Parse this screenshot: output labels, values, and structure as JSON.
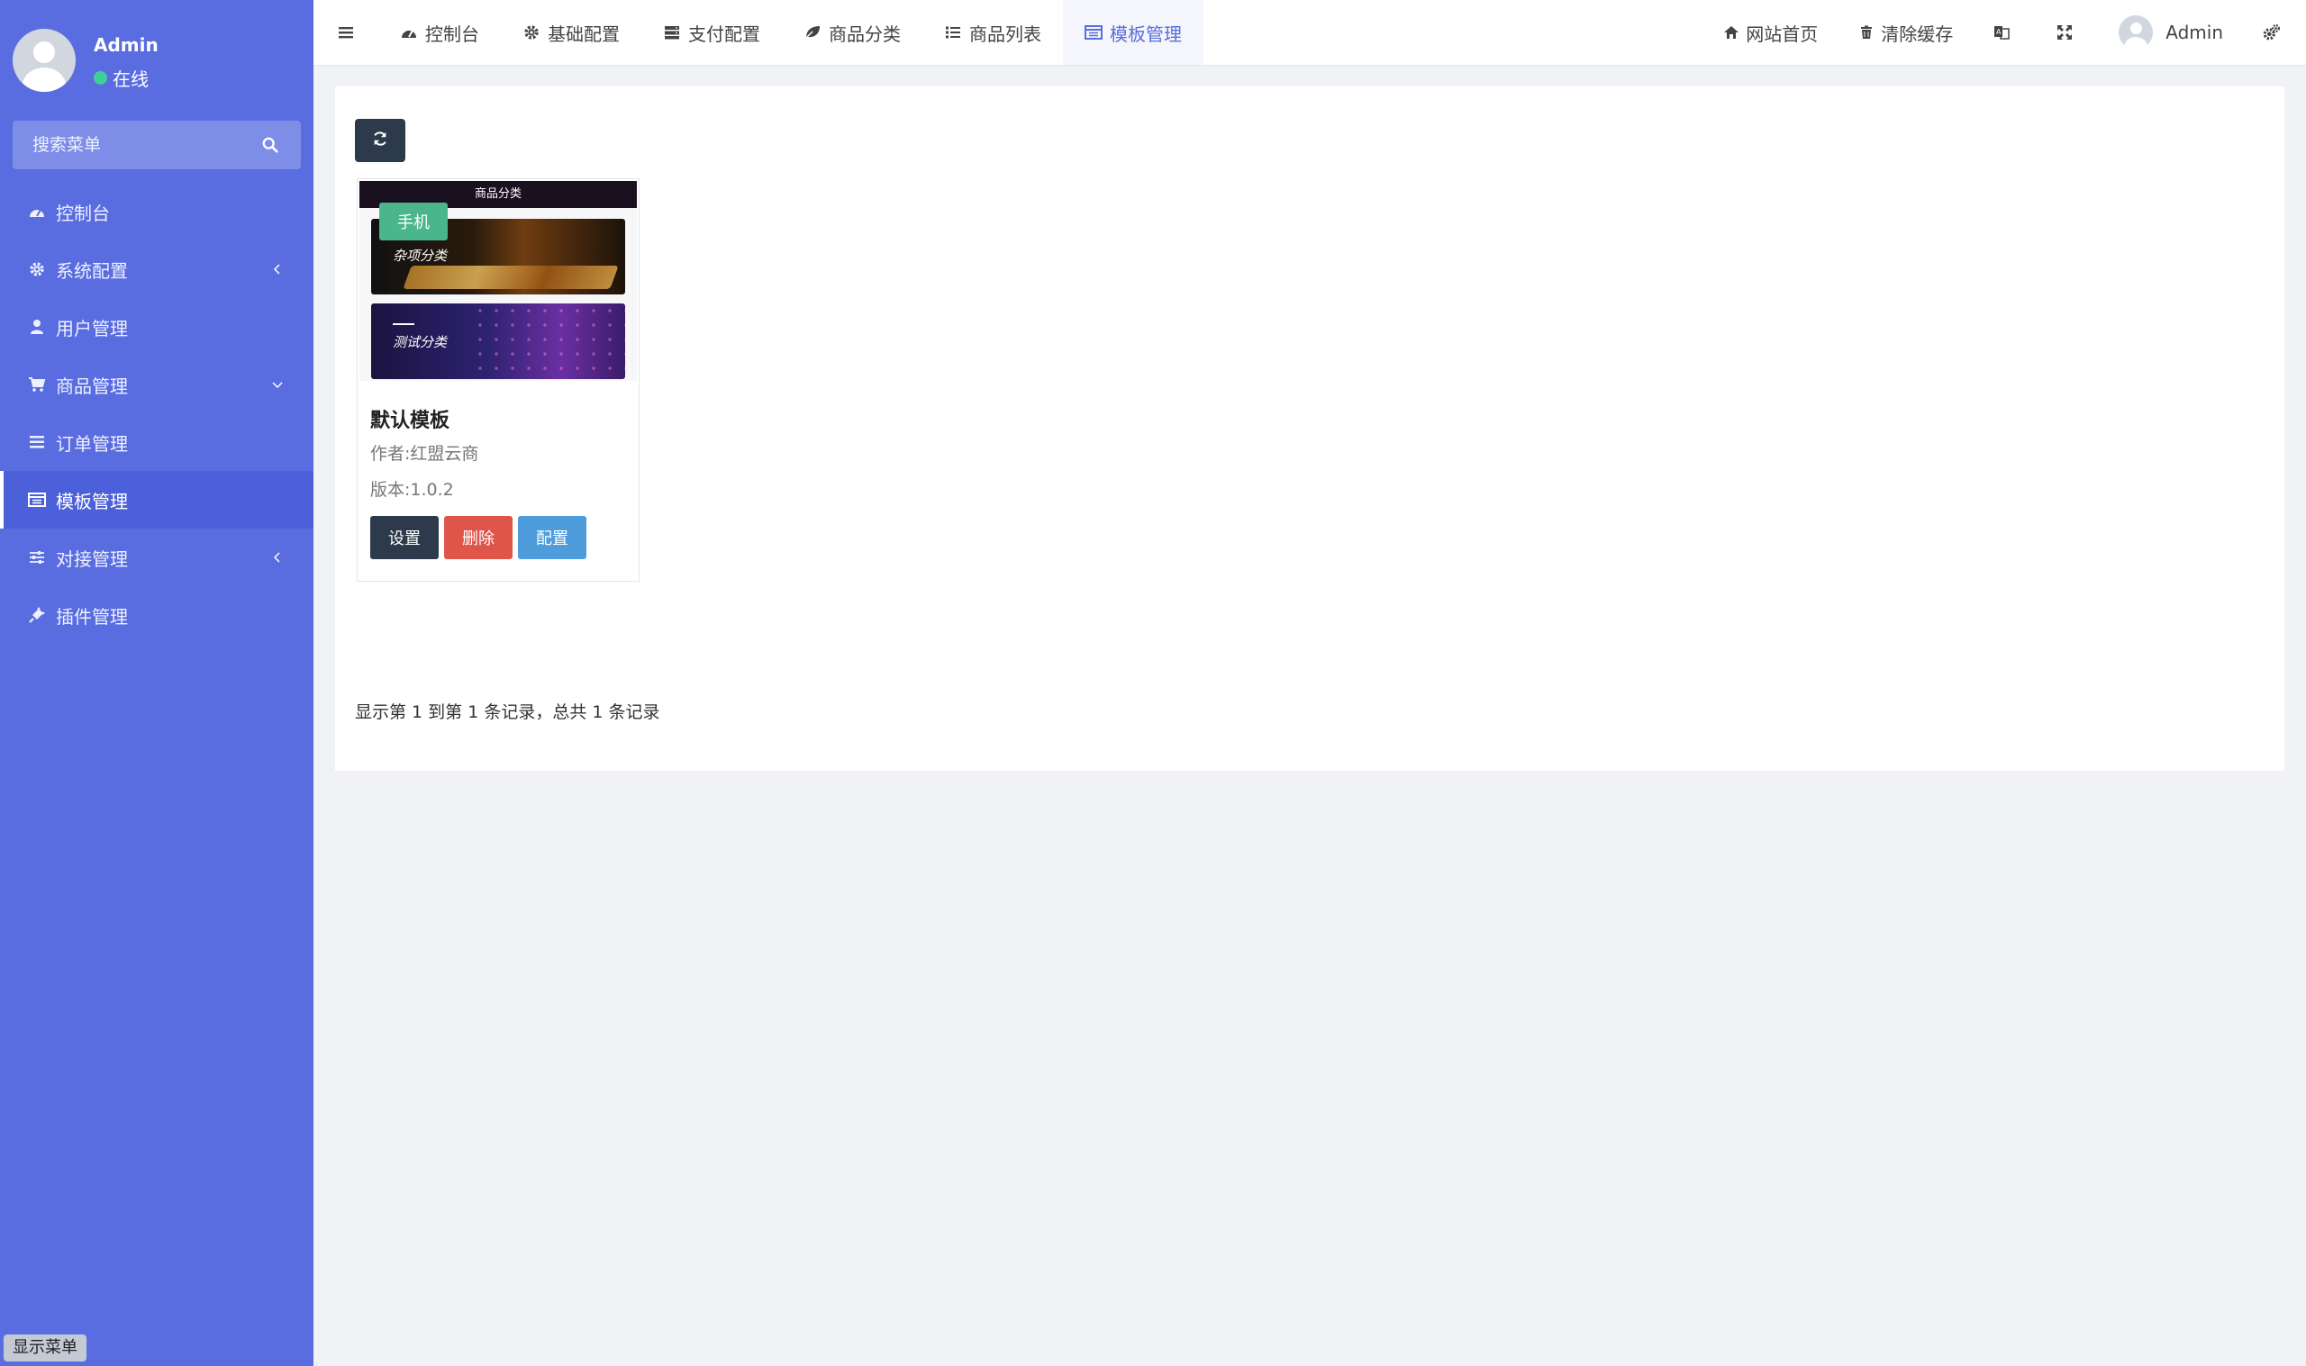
{
  "sidebar": {
    "user": {
      "name": "Admin",
      "status": "在线"
    },
    "search": {
      "placeholder": "搜索菜单"
    },
    "items": [
      {
        "label": "控制台"
      },
      {
        "label": "系统配置"
      },
      {
        "label": "用户管理"
      },
      {
        "label": "商品管理"
      },
      {
        "label": "订单管理"
      },
      {
        "label": "模板管理"
      },
      {
        "label": "对接管理"
      },
      {
        "label": "插件管理"
      }
    ],
    "show_menu_label": "显示菜单"
  },
  "topbar": {
    "tabs": [
      {
        "label": "控制台"
      },
      {
        "label": "基础配置"
      },
      {
        "label": "支付配置"
      },
      {
        "label": "商品分类"
      },
      {
        "label": "商品列表"
      },
      {
        "label": "模板管理"
      }
    ],
    "right": {
      "home_label": "网站首页",
      "clear_cache_label": "清除缓存",
      "user_label": "Admin"
    }
  },
  "templates": [
    {
      "preview_header": "商品分类",
      "preview_banner1": "杂项分类",
      "preview_banner2": "测试分类",
      "device_badge": "手机",
      "name": "默认模板",
      "author": "作者:红盟云商",
      "version": "版本:1.0.2",
      "actions": {
        "settings": "设置",
        "delete": "删除",
        "config": "配置"
      }
    }
  ],
  "pagination": {
    "info": "显示第 1 到第 1 条记录，总共 1 条记录"
  },
  "colors": {
    "sidebar_bg": "#596de0",
    "accent": "#596de0",
    "btn_dark": "#2c3a4b",
    "btn_danger": "#e0554a",
    "btn_info": "#4e9cdc",
    "badge_green": "#4bb58c",
    "status_online": "#3ed09a"
  }
}
